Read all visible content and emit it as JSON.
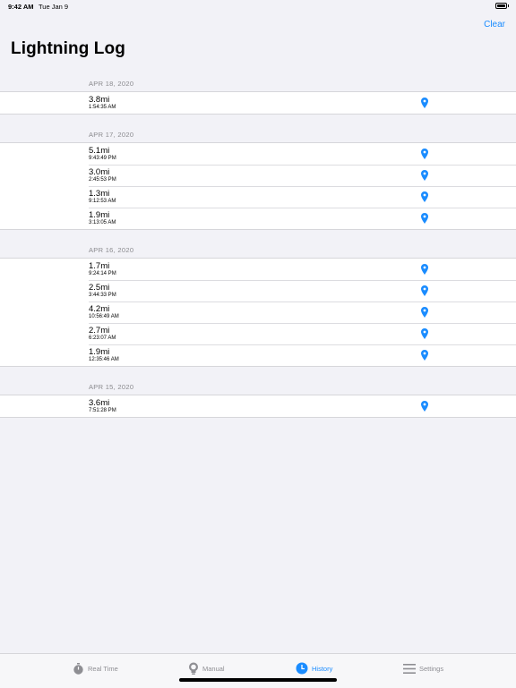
{
  "status_bar": {
    "time": "9:42 AM",
    "date": "Tue Jan 9"
  },
  "nav": {
    "clear_label": "Clear",
    "title": "Lightning Log"
  },
  "sections": [
    {
      "header": "APR 18, 2020",
      "rows": [
        {
          "distance": "3.8mi",
          "time": "1:54:35 AM"
        }
      ]
    },
    {
      "header": "APR 17, 2020",
      "rows": [
        {
          "distance": "5.1mi",
          "time": "9:43:49 PM"
        },
        {
          "distance": "3.0mi",
          "time": "2:45:53 PM"
        },
        {
          "distance": "1.3mi",
          "time": "9:12:53 AM"
        },
        {
          "distance": "1.9mi",
          "time": "3:13:05 AM"
        }
      ]
    },
    {
      "header": "APR 16, 2020",
      "rows": [
        {
          "distance": "1.7mi",
          "time": "9:24:14 PM"
        },
        {
          "distance": "2.5mi",
          "time": "3:44:33 PM"
        },
        {
          "distance": "4.2mi",
          "time": "10:56:49 AM"
        },
        {
          "distance": "2.7mi",
          "time": "6:23:07 AM"
        },
        {
          "distance": "1.9mi",
          "time": "12:35:46 AM"
        }
      ]
    },
    {
      "header": "APR 15, 2020",
      "rows": [
        {
          "distance": "3.6mi",
          "time": "7:51:28 PM"
        }
      ]
    }
  ],
  "tab_bar": {
    "tabs": [
      {
        "label": "Real Time",
        "icon": "stopwatch-icon"
      },
      {
        "label": "Manual",
        "icon": "lightbulb-icon"
      },
      {
        "label": "History",
        "icon": "clock-icon",
        "active": true
      },
      {
        "label": "Settings",
        "icon": "list-icon"
      }
    ]
  },
  "colors": {
    "accent": "#1a8cff",
    "background": "#f2f2f7",
    "inactive": "#8e8e93"
  }
}
